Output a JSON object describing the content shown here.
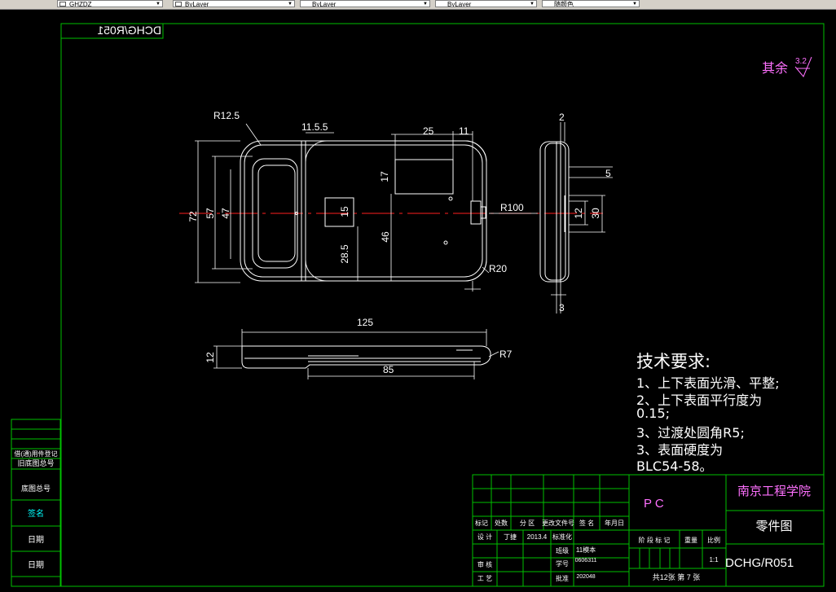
{
  "toolbar": {
    "combos": [
      {
        "name": "layer-combo",
        "value": "GHZDZ"
      },
      {
        "name": "color-combo",
        "value": "ByLayer"
      },
      {
        "name": "linetype-combo",
        "value": "ByLayer"
      },
      {
        "name": "lineweight-combo",
        "value": "ByLayer"
      },
      {
        "name": "plotstyle-combo",
        "value": "随颜色"
      }
    ]
  },
  "drawing": {
    "mirrored_code": "DCHG/R051",
    "roughness_label": "其余",
    "roughness_value": "3.2",
    "dims": {
      "r12_5": "R12.5",
      "d11_5_5": "11.5.5",
      "d25": "25",
      "d11": "11",
      "d2": "2",
      "d5": "5",
      "d72": "72",
      "d57": "57",
      "d47": "47",
      "d17": "17",
      "d15": "15",
      "d46": "46",
      "d28_5": "28.5",
      "r100": "R100",
      "d12a": "12",
      "d30": "30",
      "r20": "R20",
      "d3": "3",
      "d125": "125",
      "d12b": "12",
      "r7": "R7",
      "d85": "85"
    },
    "tech": {
      "title": "技术要求:",
      "lines": [
        "1、上下表面光滑、平整;",
        "2、上下表面平行度为",
        "0.15;",
        "3、过渡处圆角R5;",
        "3、表面硬度为",
        "BLC54-58。"
      ]
    },
    "left_strip": [
      "借(通)用件登记",
      "旧底图总号",
      "底图总号",
      "签名",
      "日期",
      "日期"
    ],
    "title_block": {
      "material": "P C",
      "school": "南京工程学院",
      "drawing_name": "零件图",
      "code": "DCHG/R051",
      "scale": "1:1",
      "sheets": "共12张  第 7 张",
      "headers": [
        "标记",
        "处数",
        "分 区",
        "更改文件号",
        "签 名",
        "年月日"
      ],
      "design_label": "设 计",
      "designer": "丁捷",
      "design_date": "2013.4",
      "std_label": "标准化",
      "class_label": "班级",
      "class_value": "11模本",
      "id_label": "学号",
      "id_value": "0606311",
      "review_label": "审 核",
      "craft_label": "工 艺",
      "approve_label": "批准",
      "approve_value": "202048",
      "stage_label": "阶 段 标 记",
      "weight_label": "重量",
      "ratio_label": "比例"
    }
  }
}
